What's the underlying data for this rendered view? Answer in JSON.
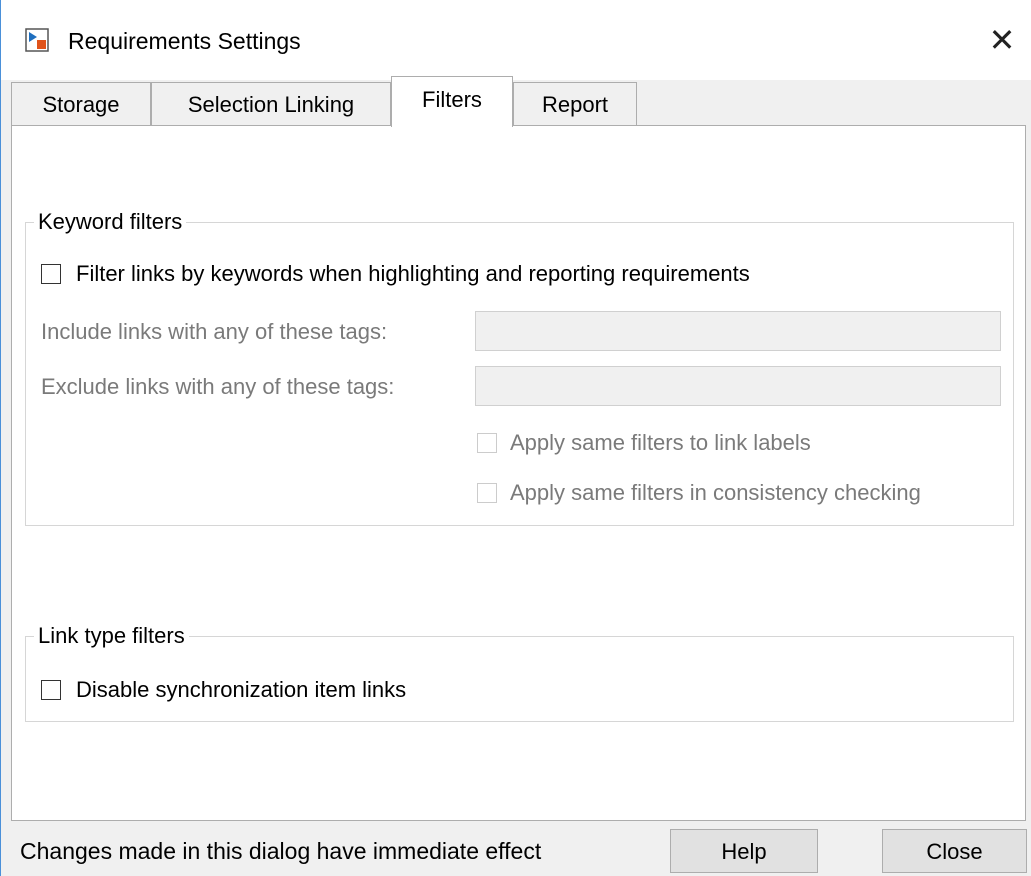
{
  "window": {
    "title": "Requirements Settings",
    "close_glyph": "✕",
    "app_icon": "simulink-requirements-icon"
  },
  "tabs": [
    {
      "label": "Storage",
      "active": false
    },
    {
      "label": "Selection Linking",
      "active": false
    },
    {
      "label": "Filters",
      "active": true
    },
    {
      "label": "Report",
      "active": false
    }
  ],
  "keyword_filters": {
    "title": "Keyword filters",
    "filter_checkbox": {
      "label": "Filter links by keywords when highlighting and reporting requirements",
      "checked": false
    },
    "include": {
      "label": "Include links with any of these tags:",
      "value": ""
    },
    "exclude": {
      "label": "Exclude links with any of these tags:",
      "value": ""
    },
    "apply_labels": {
      "label": "Apply same filters to link labels",
      "checked": false,
      "enabled": false
    },
    "apply_consistency": {
      "label": "Apply same filters in consistency checking",
      "checked": false,
      "enabled": false
    }
  },
  "link_type_filters": {
    "title": "Link type filters",
    "disable_sync": {
      "label": "Disable synchronization item links",
      "checked": false
    }
  },
  "footer": {
    "status": "Changes made in this dialog have immediate effect",
    "help_label": "Help",
    "close_label": "Close"
  },
  "colors": {
    "accent_border": "#4a90d9",
    "disabled_text": "#7a7a7a",
    "panel_bg": "#ffffff",
    "window_bg": "#f0f0f0"
  }
}
